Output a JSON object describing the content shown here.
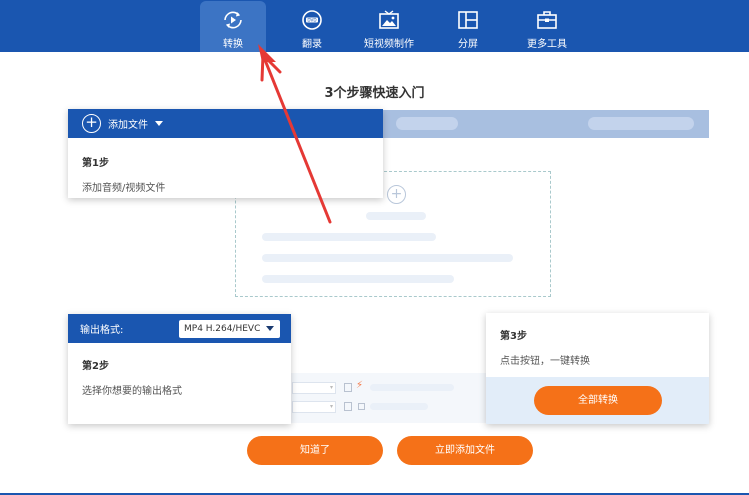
{
  "toolbar": {
    "items": [
      {
        "label": "转换",
        "icon": "convert-icon",
        "active": true
      },
      {
        "label": "翻录",
        "icon": "dvd-icon",
        "active": false
      },
      {
        "label": "短视频制作",
        "icon": "tv-image-icon",
        "active": false
      },
      {
        "label": "分屏",
        "icon": "split-screen-icon",
        "active": false
      },
      {
        "label": "更多工具",
        "icon": "toolbox-icon",
        "active": false
      }
    ]
  },
  "guide": {
    "title": "3个步骤快速入门",
    "step1": {
      "button_label": "添加文件",
      "title": "第1步",
      "desc": "添加音频/视频文件"
    },
    "step2": {
      "format_label": "输出格式:",
      "format_value": "MP4 H.264/HEVC",
      "title": "第2步",
      "desc": "选择你想要的输出格式"
    },
    "step3": {
      "title": "第3步",
      "desc": "点击按钮，一键转换",
      "button_label": "全部转换"
    },
    "actions": {
      "ok_label": "知道了",
      "add_now_label": "立即添加文件"
    }
  },
  "colors": {
    "brand": "#1a56b0",
    "accent": "#f57118",
    "pointer_arrow": "#e53935"
  }
}
